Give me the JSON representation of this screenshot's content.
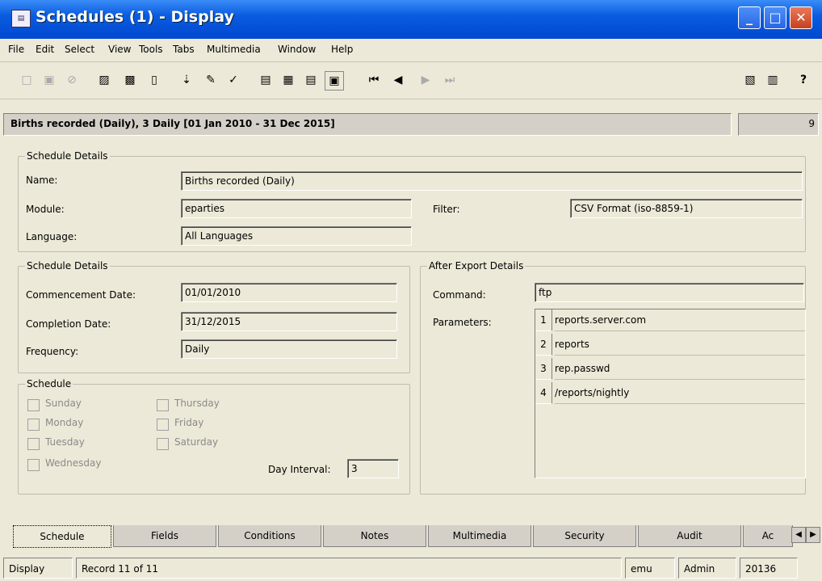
{
  "window": {
    "title": "Schedules (1) - Display",
    "icon": "app-icon",
    "controls": {
      "minimize": "_",
      "maximize": "□",
      "close": "✕"
    }
  },
  "menu": [
    "File",
    "Edit",
    "Select",
    "View",
    "Tools",
    "Tabs",
    "Multimedia",
    "Window",
    "Help"
  ],
  "toolbar": {
    "icons": [
      "new-icon",
      "save-icon",
      "cancel-icon",
      "doc-icon",
      "doc-add-icon",
      "doc-flag-icon",
      "sort-icon",
      "edit-icon",
      "spellcheck-icon",
      "view1-icon",
      "view2-icon",
      "view3-icon",
      "view4-icon",
      "first-icon",
      "prev-icon",
      "next-icon",
      "last-icon",
      "report-icon",
      "report2-icon",
      "help-icon"
    ]
  },
  "record_header": {
    "text": "Births recorded (Daily), 3 Daily [01 Jan 2010 - 31 Dec 2015]",
    "count": "9"
  },
  "schedule_details_1": {
    "legend": "Schedule Details",
    "name_label": "Name:",
    "name_value": "Births recorded (Daily)",
    "module_label": "Module:",
    "module_value": "eparties",
    "filter_label": "Filter:",
    "filter_value": "CSV Format (iso-8859-1)",
    "language_label": "Language:",
    "language_value": "All Languages"
  },
  "schedule_details_2": {
    "legend": "Schedule Details",
    "commencement_label": "Commencement Date:",
    "commencement_value": "01/01/2010",
    "completion_label": "Completion Date:",
    "completion_value": "31/12/2015",
    "frequency_label": "Frequency:",
    "frequency_value": "Daily"
  },
  "schedule": {
    "legend": "Schedule",
    "days": [
      "Sunday",
      "Monday",
      "Tuesday",
      "Wednesday",
      "Thursday",
      "Friday",
      "Saturday"
    ],
    "day_interval_label": "Day Interval:",
    "day_interval_value": "3"
  },
  "after_export": {
    "legend": "After Export Details",
    "command_label": "Command:",
    "command_value": "ftp",
    "parameters_label": "Parameters:",
    "parameters": [
      {
        "num": "1",
        "value": "reports.server.com"
      },
      {
        "num": "2",
        "value": "reports"
      },
      {
        "num": "3",
        "value": "rep.passwd"
      },
      {
        "num": "4",
        "value": "/reports/nightly"
      }
    ]
  },
  "tabs": [
    "Schedule",
    "Fields",
    "Conditions",
    "Notes",
    "Multimedia",
    "Security",
    "Audit",
    "Ac"
  ],
  "status": {
    "mode": "Display",
    "record": "Record 11 of 11",
    "user": "emu",
    "group": "Admin",
    "port": "20136"
  }
}
